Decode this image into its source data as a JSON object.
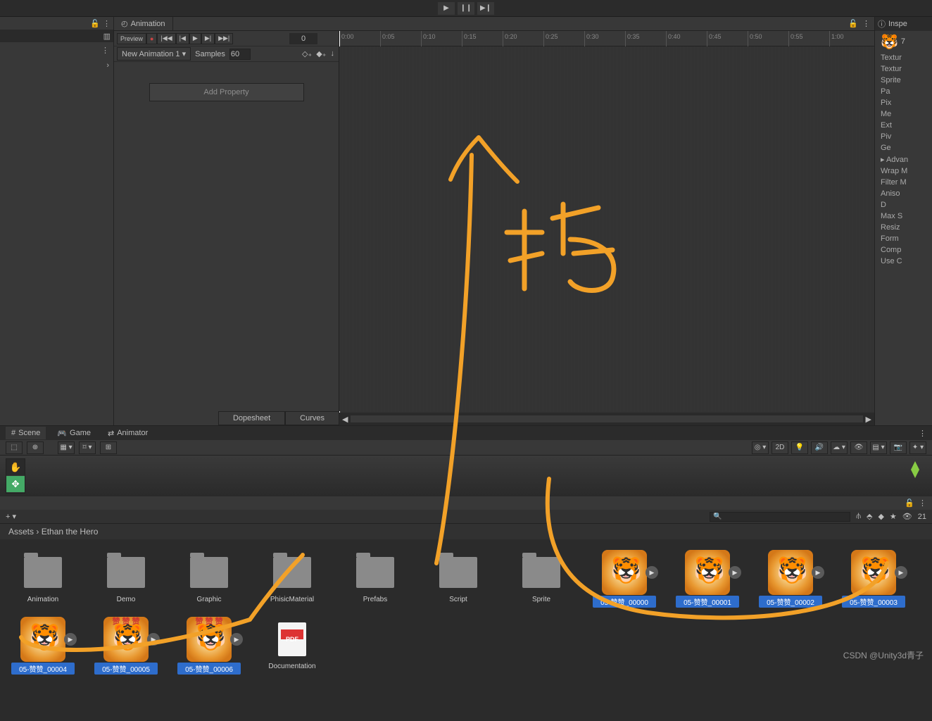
{
  "playback": {},
  "animation": {
    "tab": "Animation",
    "preview": "Preview",
    "frame": "0",
    "clip": "New Animation 1",
    "samples_label": "Samples",
    "samples": "60",
    "add_property": "Add Property",
    "dopesheet": "Dopesheet",
    "curves": "Curves",
    "ticks": [
      "0:00",
      "0:05",
      "0:10",
      "0:15",
      "0:20",
      "0:25",
      "0:30",
      "0:35",
      "0:40",
      "0:45",
      "0:50",
      "0:55",
      "1:00"
    ]
  },
  "inspector": {
    "tab": "Inspe",
    "count": "7",
    "rows": [
      "Textur",
      "Textur",
      "Sprite",
      "Pa",
      "Pix",
      "Me",
      "Ext",
      "Piv",
      "Ge",
      "▸ Advan",
      "Wrap M",
      "Filter M",
      "Aniso",
      "D",
      "Max S",
      "Resiz",
      "Form",
      "Comp",
      "Use C"
    ]
  },
  "scene": {
    "tabs": [
      "Scene",
      "Game",
      "Animator"
    ],
    "btn_2d": "2D"
  },
  "project": {
    "count": "21",
    "crumb_root": "Assets",
    "crumb_sep": "›",
    "crumb_child": "Ethan the Hero",
    "folders": [
      {
        "label": "Animation"
      },
      {
        "label": "Demo"
      },
      {
        "label": "Graphic"
      },
      {
        "label": "PhisicMaterial"
      },
      {
        "label": "Prefabs"
      },
      {
        "label": "Script"
      },
      {
        "label": "Sprite"
      }
    ],
    "textures": [
      {
        "label": "05-赞赞_00000"
      },
      {
        "label": "05-赞赞_00001"
      },
      {
        "label": "05-赞赞_00002"
      },
      {
        "label": "05-赞赞_00003"
      },
      {
        "label": "05-赞赞_00004"
      },
      {
        "label": "05-赞赞_00005"
      },
      {
        "label": "05-赞赞_00006"
      }
    ],
    "doc": "Documentation",
    "overlay_text": "赞 赞 赞"
  },
  "watermark": "CSDN @Unity3d青子"
}
